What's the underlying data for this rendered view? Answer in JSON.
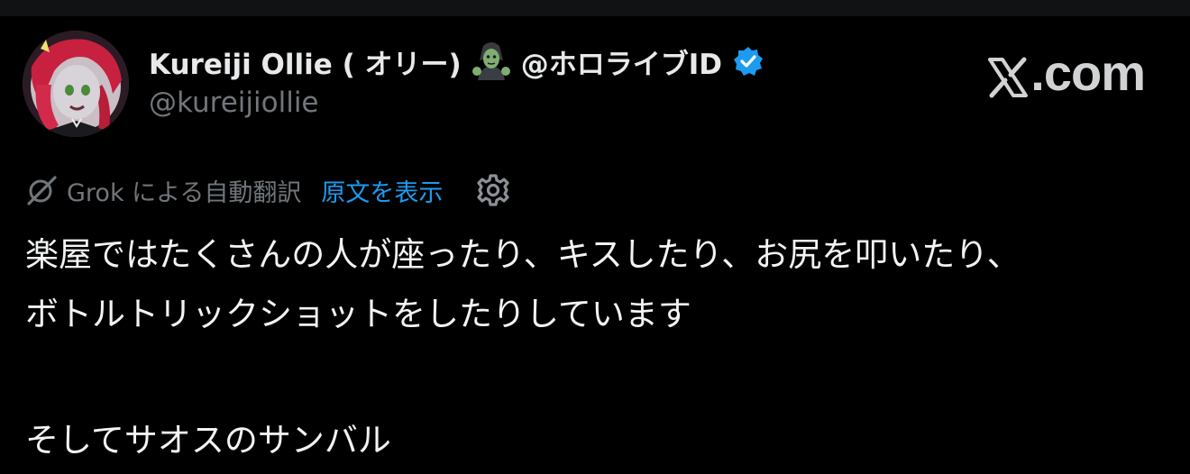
{
  "author": {
    "display_name": "Kureiji Ollie ( オリー)",
    "emoji": "zombie-emoji",
    "affiliation": "@ホロライブID",
    "verified": true,
    "handle": "@kureijiollie"
  },
  "site_logo": {
    "text": ".com",
    "icon": "x-logo-icon"
  },
  "translation": {
    "label": "Grok による自動翻訳",
    "show_original": "原文を表示",
    "icons": [
      "grok-icon",
      "gear-icon"
    ]
  },
  "tweet": {
    "lines": [
      "楽屋ではたくさんの人が座ったり、キスしたり、お尻を叩いたり、",
      "ボトルトリックショットをしたりしています",
      "",
      "そしてサオスのサンバル"
    ]
  },
  "colors": {
    "background": "#000000",
    "text": "#e7e9ea",
    "muted": "#71767b",
    "accent": "#1d9bf0"
  }
}
